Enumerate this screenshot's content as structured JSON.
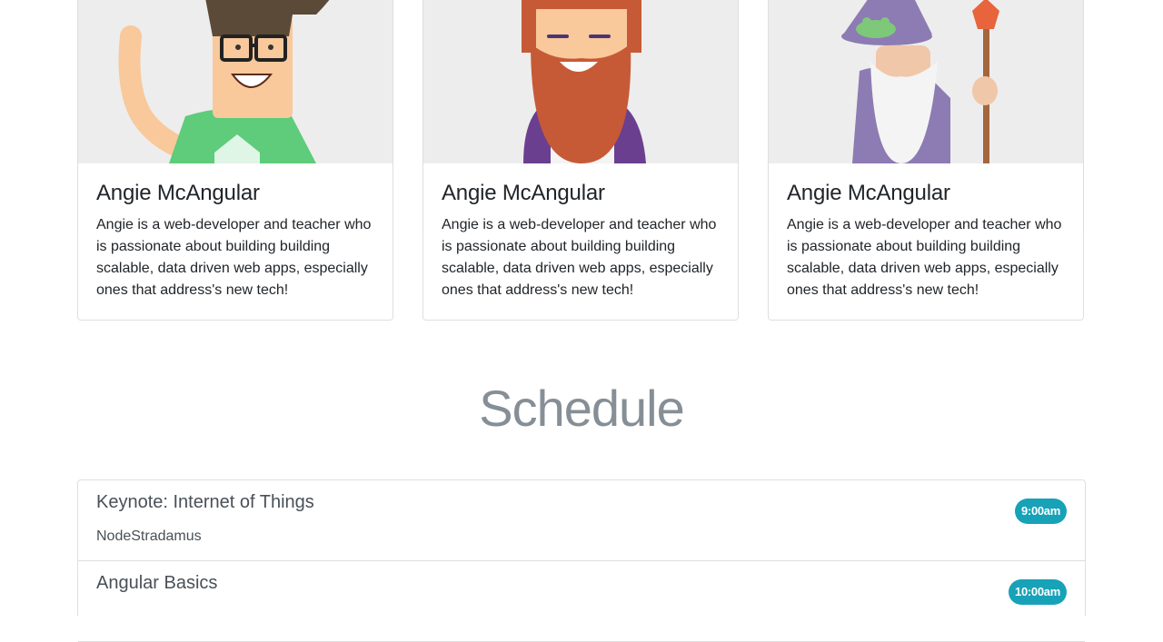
{
  "speakers": [
    {
      "name": "Angie McAngular",
      "bio": "Angie is a web-developer and teacher who is passionate about building building scalable, data driven web apps, especially ones that address's new tech!",
      "avatar_icon": "nerd-avatar-icon"
    },
    {
      "name": "Angie McAngular",
      "bio": "Angie is a web-developer and teacher who is passionate about building building scalable, data driven web apps, especially ones that address's new tech!",
      "avatar_icon": "bearded-avatar-icon"
    },
    {
      "name": "Angie McAngular",
      "bio": "Angie is a web-developer and teacher who is passionate about building building scalable, data driven web apps, especially ones that address's new tech!",
      "avatar_icon": "wizard-avatar-icon"
    }
  ],
  "schedule": {
    "title": "Schedule",
    "sessions": [
      {
        "title": "Keynote: Internet of Things",
        "speaker": "NodeStradamus",
        "time": "9:00am"
      },
      {
        "title": "Angular Basics",
        "speaker": "",
        "time": "10:00am"
      }
    ]
  },
  "colors": {
    "badge": "#17a2b8",
    "heading_muted": "#868e96",
    "card_image_bg": "#ededed"
  }
}
